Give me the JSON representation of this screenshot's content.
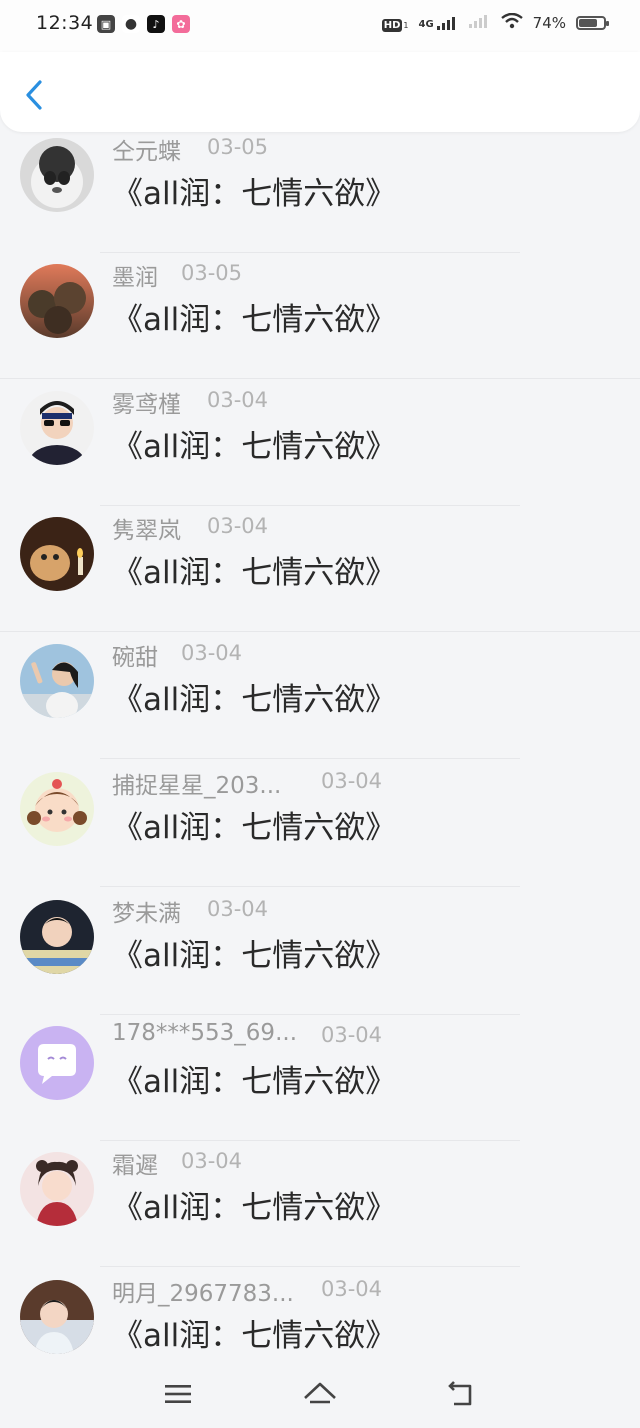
{
  "status_bar": {
    "time": "12:34",
    "battery": "74%",
    "battery_level": 0.74,
    "network": "4G",
    "hd_label": "HD",
    "hd_sub": "1",
    "app_icons": [
      "taobao-icon",
      "wechat-icon",
      "tiktok-icon",
      "pink-app-icon"
    ]
  },
  "nav": {
    "back_icon": "chevron-left-icon"
  },
  "items": [
    {
      "name": "仝元蝶",
      "date": "03-05",
      "message": "《all润：七情六欲》"
    },
    {
      "name": "墨润",
      "date": "03-05",
      "message": "《all润：七情六欲》"
    },
    {
      "name": "雾鸢槿",
      "date": "03-04",
      "message": "《all润：七情六欲》"
    },
    {
      "name": "隽翠岚",
      "date": "03-04",
      "message": "《all润：七情六欲》"
    },
    {
      "name": "碗甜",
      "date": "03-04",
      "message": "《all润：七情六欲》"
    },
    {
      "name": "捕捉星星_203...",
      "date": "03-04",
      "message": "《all润：七情六欲》"
    },
    {
      "name": "梦未满",
      "date": "03-04",
      "message": "《all润：七情六欲》"
    },
    {
      "name": "178***553_69...",
      "date": "03-04",
      "message": "《all润：七情六欲》"
    },
    {
      "name": "霜遲",
      "date": "03-04",
      "message": "《all润：七情六欲》"
    },
    {
      "name": "明月_2967783...",
      "date": "03-04",
      "message": "《all润：七情六欲》"
    }
  ],
  "bottom_nav": [
    "menu-icon",
    "home-icon",
    "back-icon"
  ],
  "colors": {
    "accent": "#2a8fe0",
    "background": "#f4f5f7"
  }
}
